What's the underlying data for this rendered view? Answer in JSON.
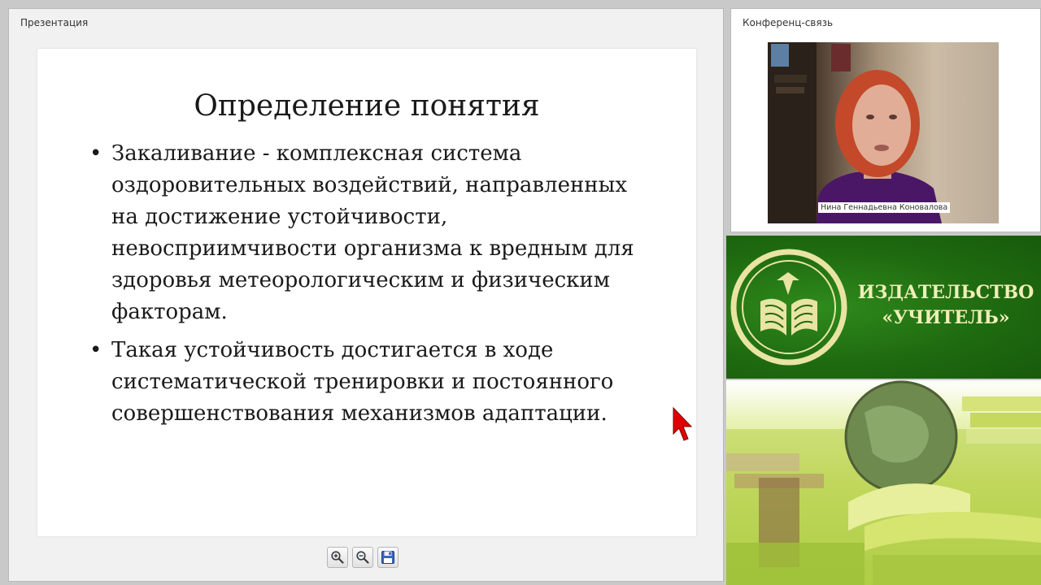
{
  "presentation": {
    "panel_title": "Презентация",
    "slide": {
      "title": "Определение понятия",
      "bullets": [
        "Закаливание - комплексная система оздоровительных воздействий, направленных на достижение устойчивости, невосприимчивости организма к вредным для здоровья метеорологическим и физическим факторам.",
        "Такая устойчивость достигается в ходе систематической тренировки и постоянного совершенствования механизмов адаптации."
      ],
      "bullet_glyph": "•"
    },
    "toolbar": {
      "zoom_in_icon": "zoom-in-icon",
      "zoom_out_icon": "zoom-out-icon",
      "save_icon": "floppy-disk-icon"
    }
  },
  "conference": {
    "panel_title": "Конференц-связь",
    "speaker_name": "Нина Геннадьевна Коновалова"
  },
  "publisher": {
    "name_line1": "ИЗДАТЕЛЬСТВО",
    "name_line2": "«УЧИТЕЛЬ»",
    "logo_icon": "open-book-emblem-icon"
  },
  "colors": {
    "brand_green": "#1f6b10",
    "brand_text": "#f0eeb8",
    "cursor_red": "#e00000"
  }
}
